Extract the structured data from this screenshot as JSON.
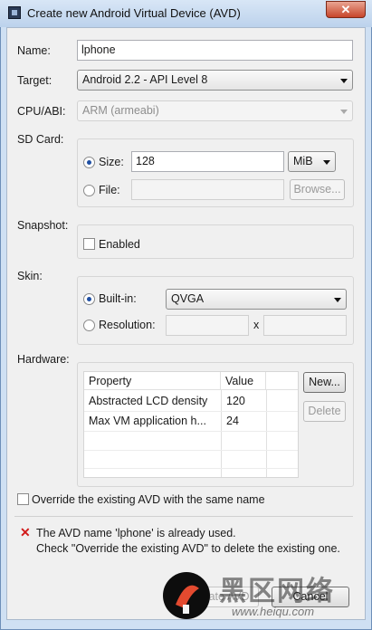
{
  "window": {
    "title": "Create new Android Virtual Device (AVD)",
    "close_label": "✕"
  },
  "name": {
    "label": "Name:",
    "value": "lphone"
  },
  "target": {
    "label": "Target:",
    "value": "Android 2.2 - API Level 8"
  },
  "cpu": {
    "label": "CPU/ABI:",
    "value": "ARM (armeabi)"
  },
  "sdcard": {
    "label": "SD Card:",
    "size_label": "Size:",
    "size_value": "128",
    "unit": "MiB",
    "file_label": "File:",
    "browse_label": "Browse..."
  },
  "snapshot": {
    "label": "Snapshot:",
    "enabled_label": "Enabled"
  },
  "skin": {
    "label": "Skin:",
    "builtin_label": "Built-in:",
    "builtin_value": "QVGA",
    "resolution_label": "Resolution:",
    "x_label": "x"
  },
  "hardware": {
    "label": "Hardware:",
    "columns": [
      "Property",
      "Value"
    ],
    "rows": [
      {
        "property": "Abstracted LCD density",
        "value": "120"
      },
      {
        "property": "Max VM application h...",
        "value": "24"
      }
    ],
    "new_label": "New...",
    "delete_label": "Delete"
  },
  "override": {
    "label": "Override the existing AVD with the same name"
  },
  "error": {
    "line1": "The AVD name 'lphone' is already used.",
    "line2": "Check \"Override the existing AVD\" to delete the existing one."
  },
  "footer": {
    "create_label": "Create AVD",
    "cancel_label": "Cancel"
  },
  "watermark": {
    "text": "黑区网络",
    "url": "www.heiqu.com"
  },
  "colors": {
    "error": "#d11b1b",
    "radio_dot": "#1f4fa3"
  }
}
